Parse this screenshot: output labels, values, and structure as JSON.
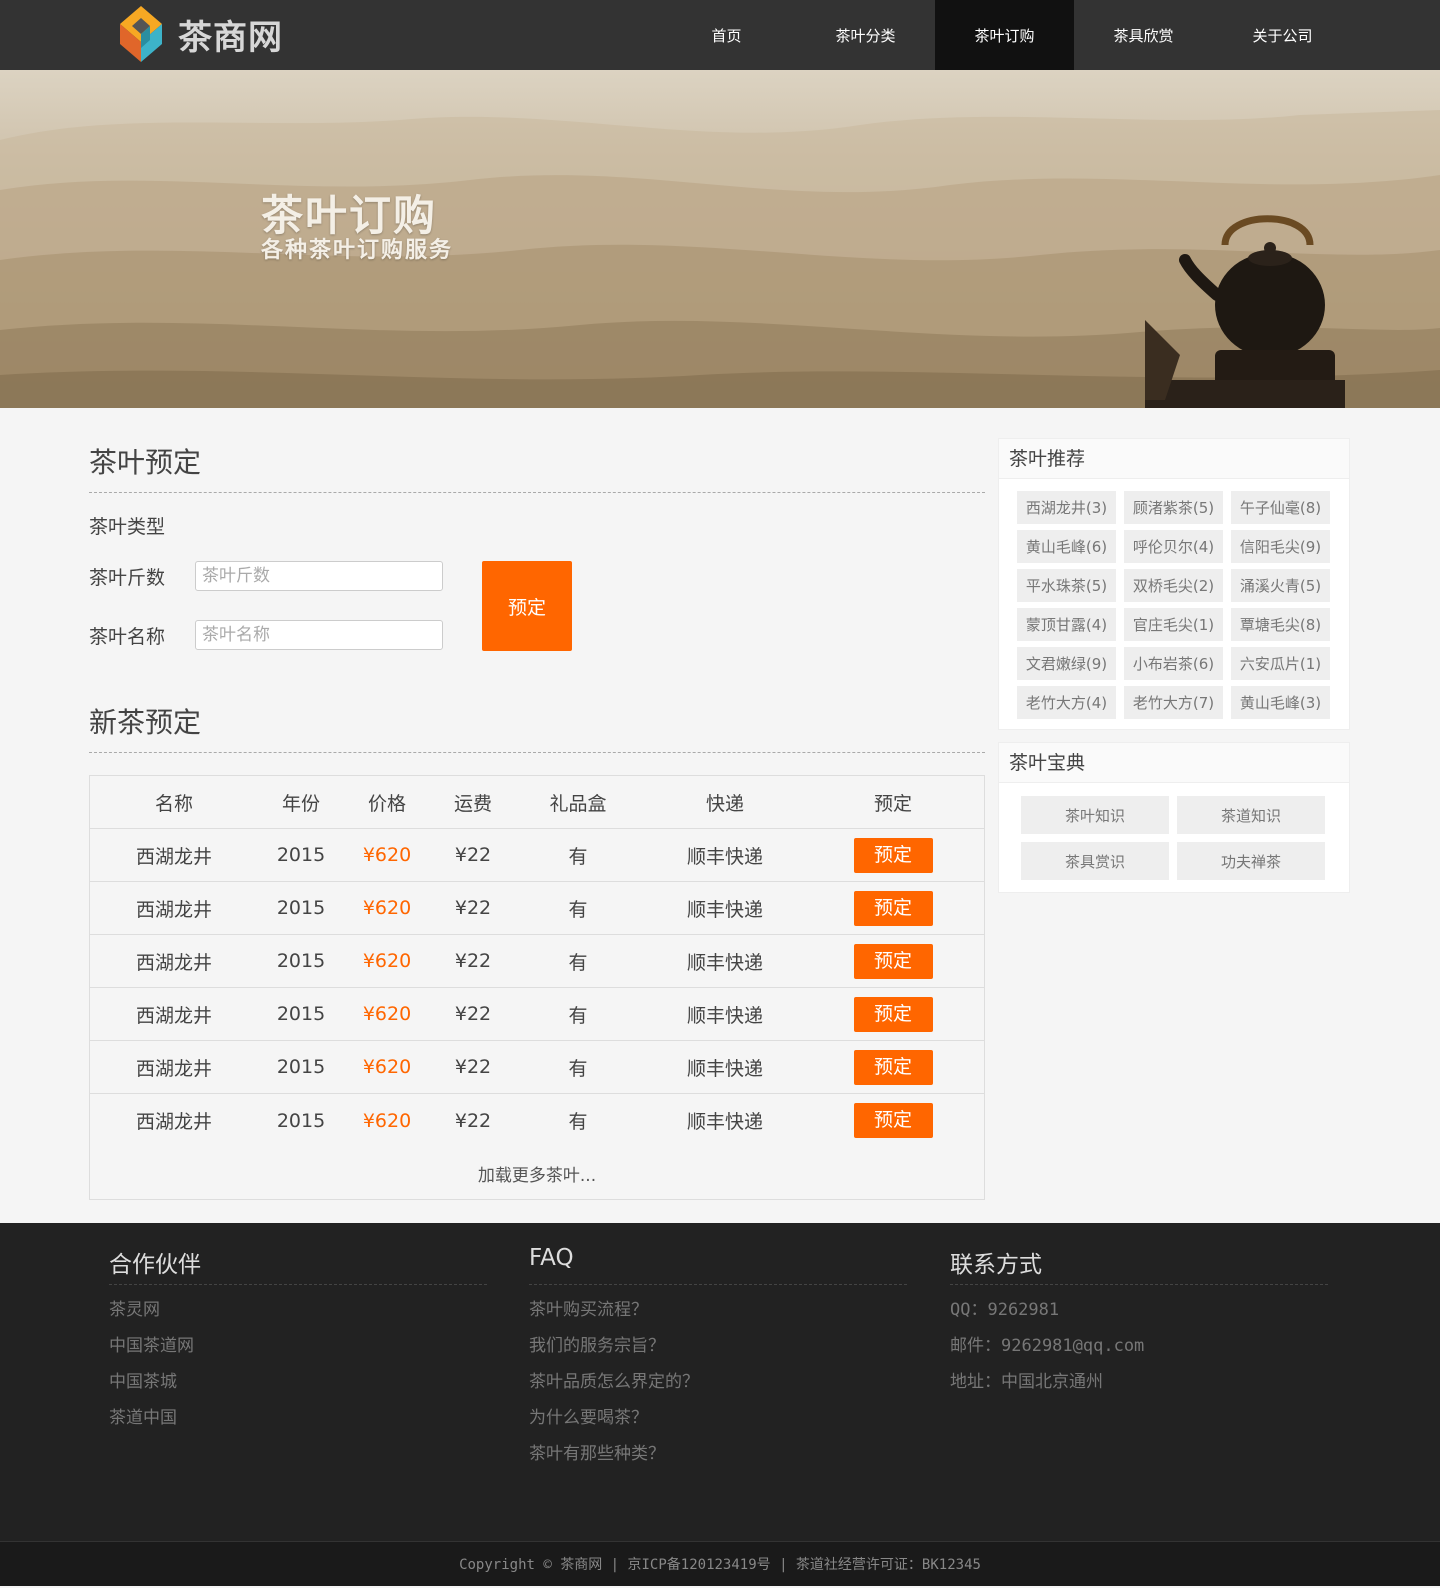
{
  "header": {
    "logo_text": "茶商网",
    "nav": [
      {
        "label": "首页",
        "active": false
      },
      {
        "label": "茶叶分类",
        "active": false
      },
      {
        "label": "茶叶订购",
        "active": true
      },
      {
        "label": "茶具欣赏",
        "active": false
      },
      {
        "label": "关于公司",
        "active": false
      }
    ]
  },
  "banner": {
    "title": "茶叶订购",
    "subtitle": "各种茶叶订购服务"
  },
  "order_form": {
    "title": "茶叶预定",
    "type_label": "茶叶类型",
    "weight_label": "茶叶斤数",
    "weight_placeholder": "茶叶斤数",
    "name_label": "茶叶名称",
    "name_placeholder": "茶叶名称",
    "submit_label": "预定"
  },
  "new_tea": {
    "title": "新茶预定",
    "headers": [
      "名称",
      "年份",
      "价格",
      "运费",
      "礼品盒",
      "快递",
      "预定"
    ],
    "rows": [
      {
        "name": "西湖龙井",
        "year": "2015",
        "price": "¥620",
        "shipping": "¥22",
        "gift_box": "有",
        "courier": "顺丰快递",
        "action": "预定"
      },
      {
        "name": "西湖龙井",
        "year": "2015",
        "price": "¥620",
        "shipping": "¥22",
        "gift_box": "有",
        "courier": "顺丰快递",
        "action": "预定"
      },
      {
        "name": "西湖龙井",
        "year": "2015",
        "price": "¥620",
        "shipping": "¥22",
        "gift_box": "有",
        "courier": "顺丰快递",
        "action": "预定"
      },
      {
        "name": "西湖龙井",
        "year": "2015",
        "price": "¥620",
        "shipping": "¥22",
        "gift_box": "有",
        "courier": "顺丰快递",
        "action": "预定"
      },
      {
        "name": "西湖龙井",
        "year": "2015",
        "price": "¥620",
        "shipping": "¥22",
        "gift_box": "有",
        "courier": "顺丰快递",
        "action": "预定"
      },
      {
        "name": "西湖龙井",
        "year": "2015",
        "price": "¥620",
        "shipping": "¥22",
        "gift_box": "有",
        "courier": "顺丰快递",
        "action": "预定"
      }
    ],
    "load_more": "加载更多茶叶..."
  },
  "recommend": {
    "title": "茶叶推荐",
    "tags": [
      "西湖龙井(3)",
      "顾渚紫茶(5)",
      "午子仙毫(8)",
      "黄山毛峰(6)",
      "呼伦贝尔(4)",
      "信阳毛尖(9)",
      "平水珠茶(5)",
      "双桥毛尖(2)",
      "涌溪火青(5)",
      "蒙顶甘露(4)",
      "官庄毛尖(1)",
      "覃塘毛尖(8)",
      "文君嫩绿(9)",
      "小布岩茶(6)",
      "六安瓜片(1)",
      "老竹大方(4)",
      "老竹大方(7)",
      "黄山毛峰(3)"
    ]
  },
  "handbook": {
    "title": "茶叶宝典",
    "items": [
      "茶叶知识",
      "茶道知识",
      "茶具赏识",
      "功夫禅茶"
    ]
  },
  "footer": {
    "partners": {
      "title": "合作伙伴",
      "links": [
        "茶灵网",
        "中国茶道网",
        "中国茶城",
        "茶道中国"
      ]
    },
    "faq": {
      "title": "FAQ",
      "links": [
        "茶叶购买流程？",
        "我们的服务宗旨？",
        "茶叶品质怎么界定的？",
        "为什么要喝茶？",
        "茶叶有那些种类？"
      ]
    },
    "contact": {
      "title": "联系方式",
      "lines": [
        "QQ：9262981",
        "邮件：9262981@qq.com",
        "地址：中国北京通州"
      ]
    },
    "copyright": "Copyright © 茶商网 | 京ICP备120123419号 | 茶道社经营许可证：BK12345"
  },
  "colors": {
    "accent": "#ff6600",
    "nav_bg": "#333333",
    "footer_bg": "#222222"
  }
}
